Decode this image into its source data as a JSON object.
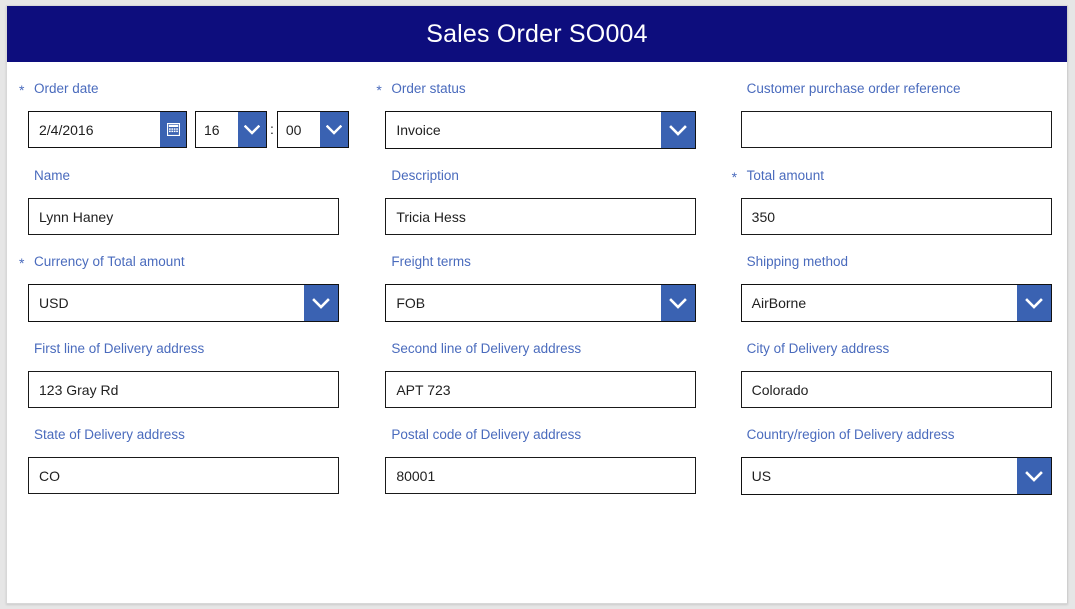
{
  "header": {
    "title": "Sales Order SO004",
    "background_color": "#0d0d7d",
    "text_color": "#ffffff"
  },
  "theme": {
    "label_color": "#4a6bbd",
    "accent_button_color": "#3a62b2",
    "field_border_color": "#111111",
    "page_background": "#e6e6e6",
    "card_background": "#ffffff"
  },
  "form": {
    "required_marker": "*",
    "time_separator": ":",
    "rows": [
      {
        "fields": [
          {
            "name": "order-date",
            "label": "Order date",
            "required": true,
            "type": "datetime",
            "date_value": "2/4/2016",
            "hour_value": "16",
            "minute_value": "00",
            "calendar_icon": "calendar-icon",
            "dropdown_icon": "chevron-down-icon"
          },
          {
            "name": "order-status",
            "label": "Order status",
            "required": true,
            "type": "select",
            "value": "Invoice",
            "placeholder": "",
            "dropdown_icon": "chevron-down-icon"
          },
          {
            "name": "customer-purchase-order-reference",
            "label": "Customer purchase order reference",
            "required": false,
            "type": "text",
            "value": "",
            "placeholder": ""
          }
        ]
      },
      {
        "fields": [
          {
            "name": "name",
            "label": "Name",
            "required": false,
            "type": "text",
            "value": "Lynn Haney",
            "placeholder": ""
          },
          {
            "name": "description",
            "label": "Description",
            "required": false,
            "type": "text",
            "value": "Tricia Hess",
            "placeholder": ""
          },
          {
            "name": "total-amount",
            "label": "Total amount",
            "required": true,
            "type": "text",
            "value": "350",
            "placeholder": ""
          }
        ]
      },
      {
        "fields": [
          {
            "name": "currency-of-total-amount",
            "label": "Currency of Total amount",
            "required": true,
            "type": "select",
            "value": "USD",
            "placeholder": "",
            "dropdown_icon": "chevron-down-icon"
          },
          {
            "name": "freight-terms",
            "label": "Freight terms",
            "required": false,
            "type": "select",
            "value": "FOB",
            "placeholder": "",
            "dropdown_icon": "chevron-down-icon"
          },
          {
            "name": "shipping-method",
            "label": "Shipping method",
            "required": false,
            "type": "select",
            "value": "AirBorne",
            "placeholder": "",
            "dropdown_icon": "chevron-down-icon"
          }
        ]
      },
      {
        "fields": [
          {
            "name": "first-line-of-delivery-address",
            "label": "First line of Delivery address",
            "required": false,
            "type": "text",
            "value": "123 Gray Rd",
            "placeholder": ""
          },
          {
            "name": "second-line-of-delivery-address",
            "label": "Second line of Delivery address",
            "required": false,
            "type": "text",
            "value": "APT 723",
            "placeholder": ""
          },
          {
            "name": "city-of-delivery-address",
            "label": "City of Delivery address",
            "required": false,
            "type": "text",
            "value": "Colorado",
            "placeholder": ""
          }
        ]
      },
      {
        "fields": [
          {
            "name": "state-of-delivery-address",
            "label": "State of Delivery address",
            "required": false,
            "type": "text",
            "value": "CO",
            "placeholder": ""
          },
          {
            "name": "postal-code-of-delivery-address",
            "label": "Postal code of Delivery address",
            "required": false,
            "type": "text",
            "value": "80001",
            "placeholder": ""
          },
          {
            "name": "country-region-of-delivery-address",
            "label": "Country/region of Delivery address",
            "required": false,
            "type": "select",
            "value": "US",
            "placeholder": "",
            "dropdown_icon": "chevron-down-icon"
          }
        ]
      }
    ]
  }
}
